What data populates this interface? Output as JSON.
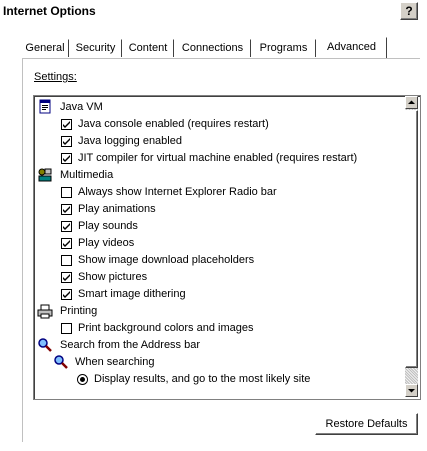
{
  "window": {
    "title": "Internet Options",
    "help_label": "?"
  },
  "tabs": [
    {
      "label": "General",
      "active": false
    },
    {
      "label": "Security",
      "active": false
    },
    {
      "label": "Content",
      "active": false
    },
    {
      "label": "Connections",
      "active": false
    },
    {
      "label": "Programs",
      "active": false
    },
    {
      "label": "Advanced",
      "active": true
    }
  ],
  "settings": {
    "label": "Settings:",
    "items": [
      {
        "label": "Java VM",
        "kind": "category",
        "icon": "java-vm-icon"
      },
      {
        "label": "Java console enabled (requires restart)",
        "kind": "checkbox",
        "checked": true
      },
      {
        "label": "Java logging enabled",
        "kind": "checkbox",
        "checked": true
      },
      {
        "label": "JIT compiler for virtual machine enabled (requires restart)",
        "kind": "checkbox",
        "checked": true
      },
      {
        "label": "Multimedia",
        "kind": "category",
        "icon": "multimedia-icon"
      },
      {
        "label": "Always show Internet Explorer Radio bar",
        "kind": "checkbox",
        "checked": false
      },
      {
        "label": "Play animations",
        "kind": "checkbox",
        "checked": true
      },
      {
        "label": "Play sounds",
        "kind": "checkbox",
        "checked": true
      },
      {
        "label": "Play videos",
        "kind": "checkbox",
        "checked": true
      },
      {
        "label": "Show image download placeholders",
        "kind": "checkbox",
        "checked": false
      },
      {
        "label": "Show pictures",
        "kind": "checkbox",
        "checked": true
      },
      {
        "label": "Smart image dithering",
        "kind": "checkbox",
        "checked": true
      },
      {
        "label": "Printing",
        "kind": "category",
        "icon": "printer-icon"
      },
      {
        "label": "Print background colors and images",
        "kind": "checkbox",
        "checked": false
      },
      {
        "label": "Search from the Address bar",
        "kind": "category",
        "icon": "search-icon"
      },
      {
        "label": "When searching",
        "kind": "subcategory",
        "icon": "search-icon"
      },
      {
        "label": "Display results, and go to the most likely site",
        "kind": "radio",
        "checked": true
      }
    ]
  },
  "buttons": {
    "restore_defaults": "Restore Defaults"
  }
}
